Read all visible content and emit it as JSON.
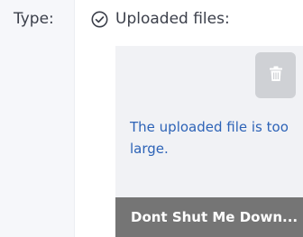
{
  "field": {
    "label": "Type:"
  },
  "uploads": {
    "title": "Uploaded files:",
    "status_icon": "check-circle-icon",
    "file": {
      "error_message": "The uploaded file is too large.",
      "name_truncated": "Dont Shut Me Down...",
      "delete_icon": "trash-icon"
    }
  },
  "colors": {
    "error_text": "#2d63b7",
    "filename_bar": "#757575",
    "card_bg": "#f1f2f5",
    "delete_bg": "#cfd1d5"
  }
}
